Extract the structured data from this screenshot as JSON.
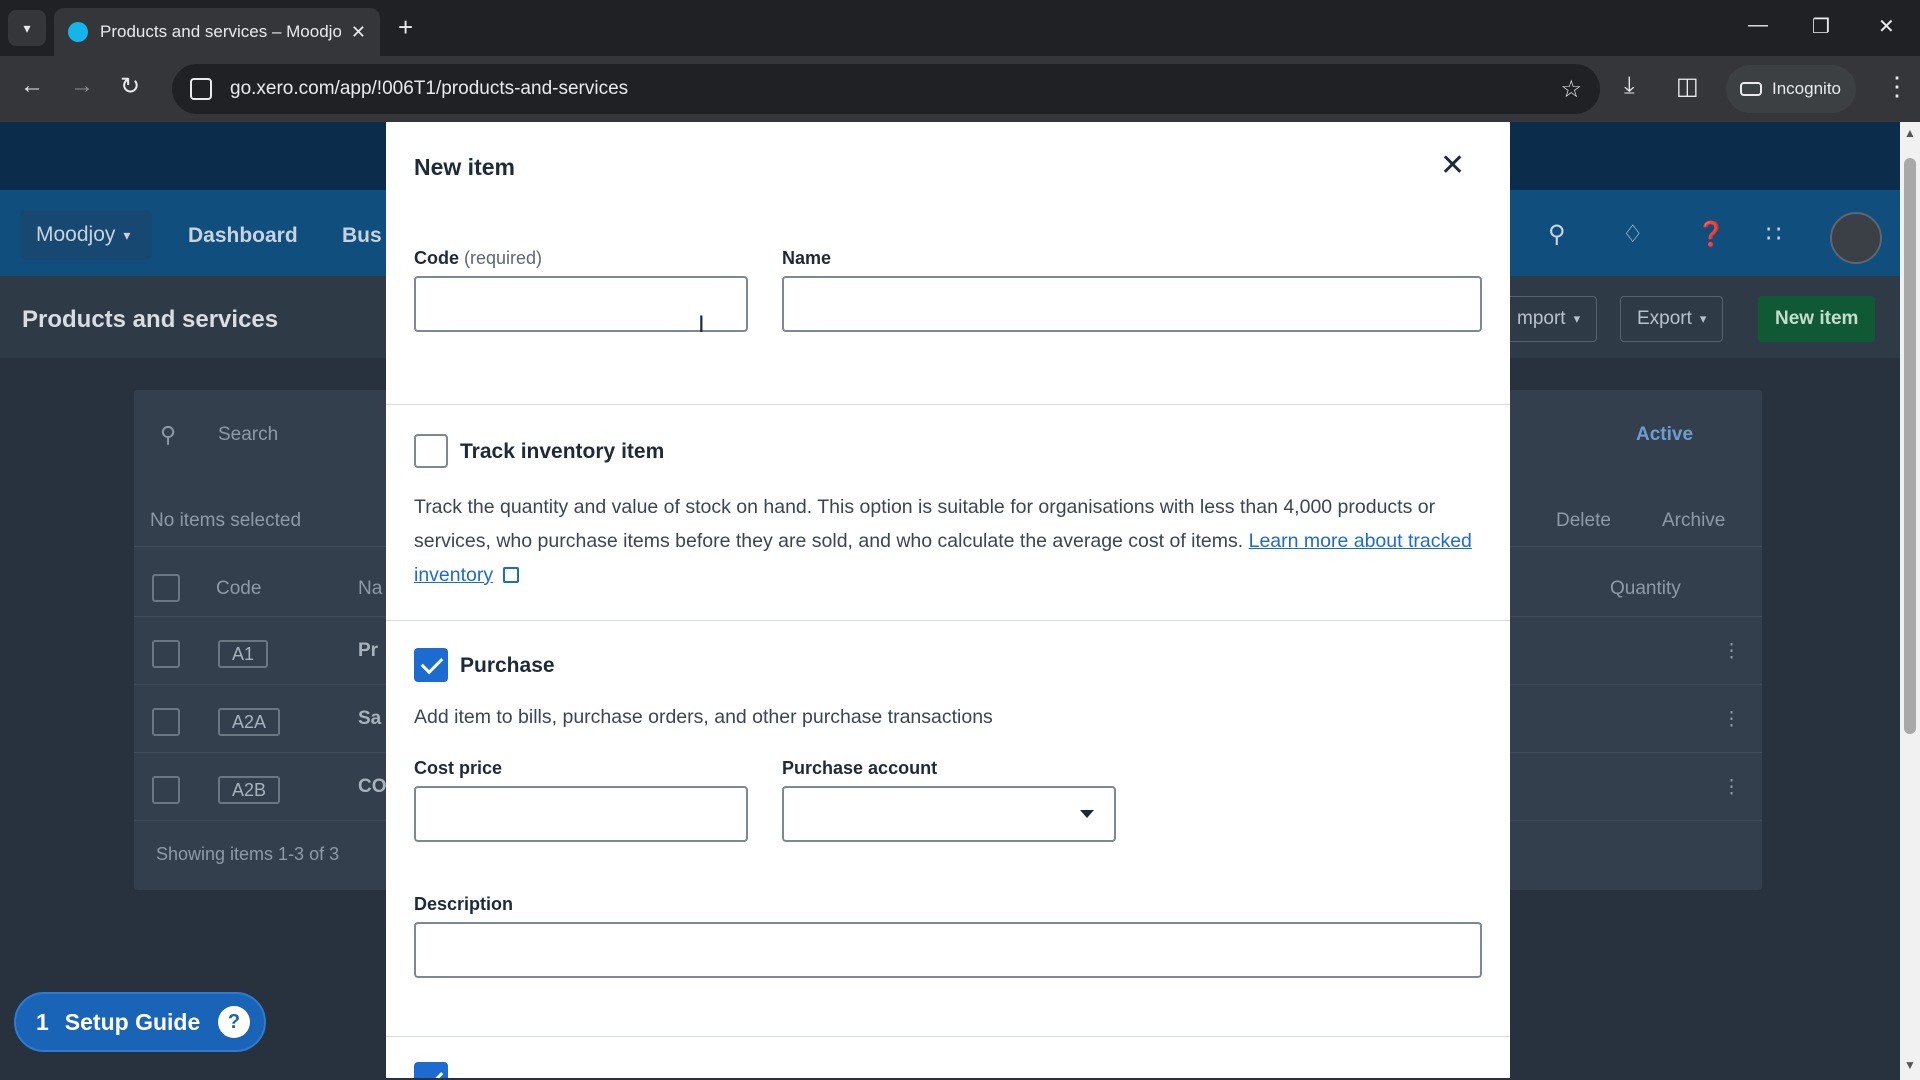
{
  "browser": {
    "tab_title": "Products and services – Moodjoy",
    "tab_close": "✕",
    "new_tab": "+",
    "url": "go.xero.com/app/!006T1/products-and-services",
    "incognito_label": "Incognito"
  },
  "app": {
    "org_name": "Moodjoy",
    "nav": {
      "dashboard": "Dashboard",
      "business": "Bus"
    },
    "page_title": "Products and services",
    "buttons": {
      "import": "mport",
      "export": "Export",
      "new_item": "New item"
    },
    "search_placeholder": "Search",
    "filter": "Active",
    "selection_status": "No items selected",
    "bulk_actions": {
      "delete": "Delete",
      "archive": "Archive"
    },
    "table": {
      "col_code": "Code",
      "col_name": "Na",
      "col_quantity": "Quantity",
      "rows": [
        {
          "code": "A1",
          "name": "Pr"
        },
        {
          "code": "A2A",
          "name": "Sa"
        },
        {
          "code": "A2B",
          "name": "CO"
        }
      ]
    },
    "footer": "Showing items 1-3 of 3"
  },
  "setup_guide": {
    "count": "1",
    "label": "Setup Guide"
  },
  "modal": {
    "title": "New item",
    "code_label": "Code",
    "code_required": "(required)",
    "code_value": "",
    "name_label": "Name",
    "name_value": "",
    "track_inventory": {
      "label": "Track inventory item",
      "checked": false,
      "description": "Track the quantity and value of stock on hand. This option is suitable for organisations with less than 4,000 products or services, who purchase items before they are sold, and who calculate the average cost of items.",
      "link_text": "Learn more about tracked inventory"
    },
    "purchase": {
      "label": "Purchase",
      "checked": true,
      "description": "Add item to bills, purchase orders, and other purchase transactions",
      "cost_price_label": "Cost price",
      "cost_price_value": "",
      "account_label": "Purchase account",
      "account_value": "",
      "description_label": "Description",
      "description_value": ""
    },
    "sell": {
      "checked": true
    }
  },
  "colors": {
    "accent": "#1c6bd0",
    "xero_green": "#0f5a34",
    "nav_blue": "#0f4e7d"
  }
}
